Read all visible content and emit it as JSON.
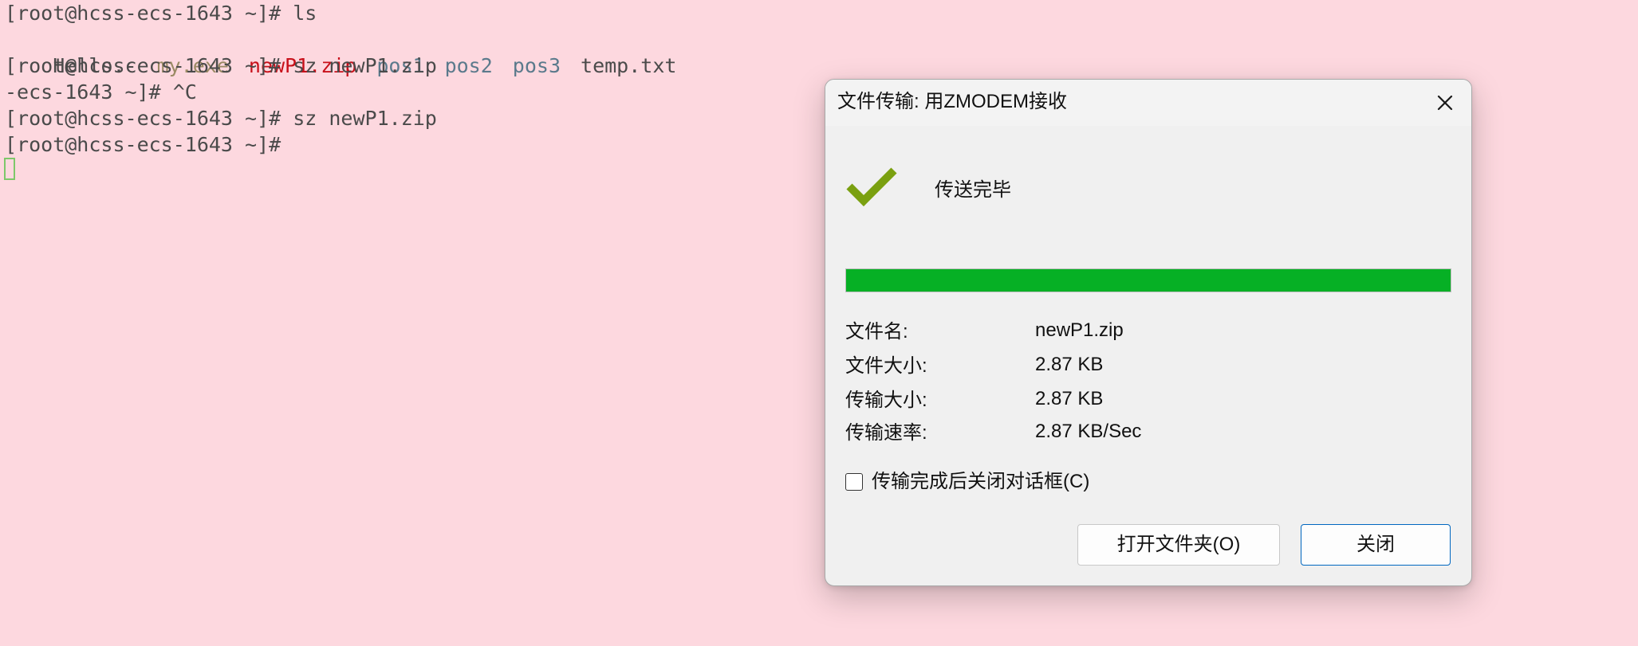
{
  "terminal": {
    "lines": [
      "[root@hcss-ecs-1643 ~]# ls",
      "",
      "[root@hcss-ecs-1643 ~]# sz newP1.zip",
      "-ecs-1643 ~]# ^C",
      "[root@hcss-ecs-1643 ~]# sz newP1.zip",
      "[root@hcss-ecs-1643 ~]#"
    ],
    "ls_output": [
      {
        "name": "Hello.c",
        "color": "#4a4a4a"
      },
      {
        "name": "my.exe",
        "color": "#9a8a64"
      },
      {
        "name": "newP1.zip",
        "color": "#c8101a"
      },
      {
        "name": "pos1",
        "color": "#5b7a8c"
      },
      {
        "name": "pos2",
        "color": "#5b7a8c"
      },
      {
        "name": "pos3",
        "color": "#5b7a8c"
      },
      {
        "name": "temp.txt",
        "color": "#4a4a4a"
      }
    ],
    "background_color": "#fdd8df",
    "cursor_color": "#7ec86a"
  },
  "dialog": {
    "title": "文件传输: 用ZMODEM接收",
    "close_icon": "close-icon",
    "status_icon": "checkmark-icon",
    "status_icon_color": "#7aa010",
    "status": "传送完毕",
    "progress": 1.0,
    "progress_color": "#06b025",
    "info": {
      "filename_label": "文件名:",
      "filename_value": "newP1.zip",
      "filesize_label": "文件大小:",
      "filesize_value": "2.87 KB",
      "transferred_label": "传输大小:",
      "transferred_value": "2.87 KB",
      "rate_label": "传输速率:",
      "rate_value": "2.87 KB/Sec"
    },
    "auto_close_label": "传输完成后关闭对话框(C)",
    "auto_close_checked": false,
    "open_folder_button": "打开文件夹(O)",
    "close_button": "关闭",
    "accent_color": "#0067c0"
  }
}
